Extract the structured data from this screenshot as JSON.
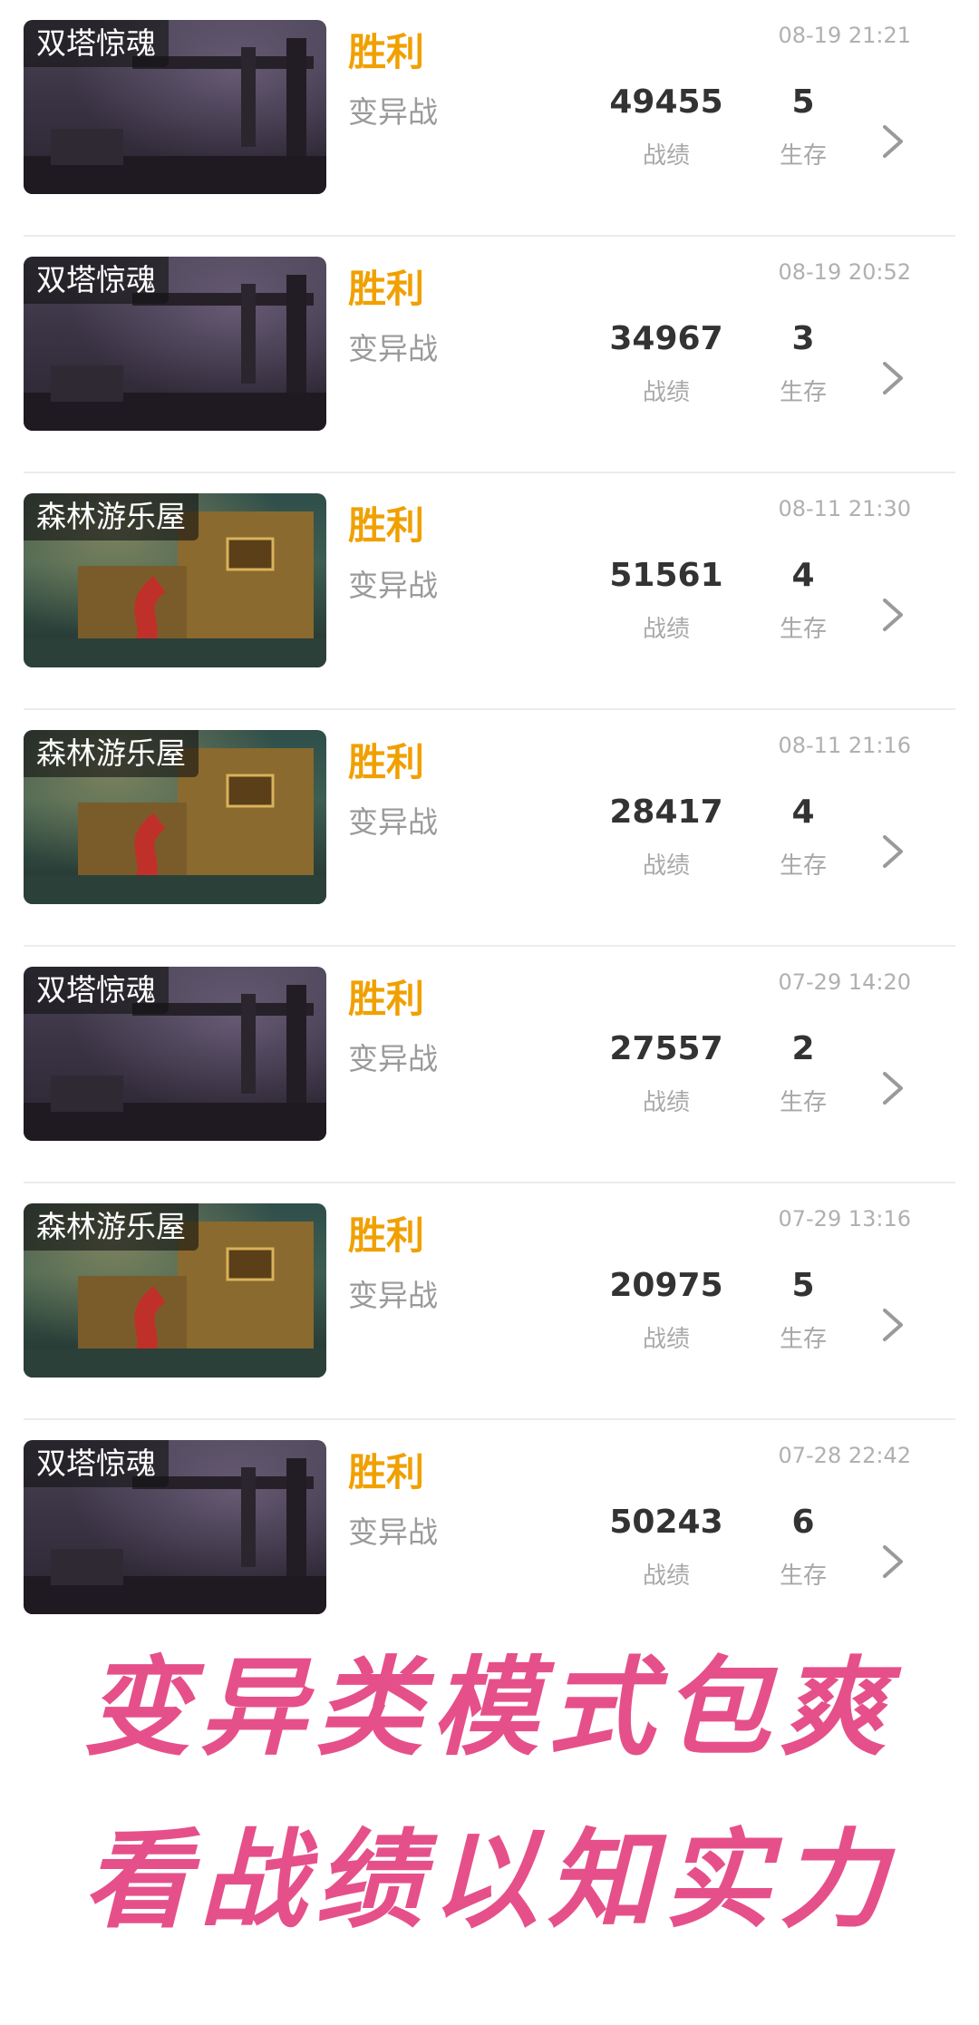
{
  "records": [
    {
      "map": "双塔惊魂",
      "theme": "tower",
      "result": "胜利",
      "mode": "变异战",
      "time": "08-19 21:21",
      "score": "49455",
      "score_label": "战绩",
      "survive": "5",
      "survive_label": "生存"
    },
    {
      "map": "双塔惊魂",
      "theme": "tower",
      "result": "胜利",
      "mode": "变异战",
      "time": "08-19 20:52",
      "score": "34967",
      "score_label": "战绩",
      "survive": "3",
      "survive_label": "生存"
    },
    {
      "map": "森林游乐屋",
      "theme": "forest",
      "result": "胜利",
      "mode": "变异战",
      "time": "08-11 21:30",
      "score": "51561",
      "score_label": "战绩",
      "survive": "4",
      "survive_label": "生存"
    },
    {
      "map": "森林游乐屋",
      "theme": "forest",
      "result": "胜利",
      "mode": "变异战",
      "time": "08-11 21:16",
      "score": "28417",
      "score_label": "战绩",
      "survive": "4",
      "survive_label": "生存"
    },
    {
      "map": "双塔惊魂",
      "theme": "tower",
      "result": "胜利",
      "mode": "变异战",
      "time": "07-29 14:20",
      "score": "27557",
      "score_label": "战绩",
      "survive": "2",
      "survive_label": "生存"
    },
    {
      "map": "森林游乐屋",
      "theme": "forest",
      "result": "胜利",
      "mode": "变异战",
      "time": "07-29 13:16",
      "score": "20975",
      "score_label": "战绩",
      "survive": "5",
      "survive_label": "生存"
    },
    {
      "map": "双塔惊魂",
      "theme": "tower",
      "result": "胜利",
      "mode": "变异战",
      "time": "07-28 22:42",
      "score": "50243",
      "score_label": "战绩",
      "survive": "6",
      "survive_label": "生存"
    }
  ],
  "caption": {
    "line1": "变异类模式包爽",
    "line2": "看战绩以知实力"
  },
  "colors": {
    "result": "#f0a000",
    "caption": "#e6508a"
  },
  "icons": {
    "row_action": "chevron-right-icon"
  }
}
